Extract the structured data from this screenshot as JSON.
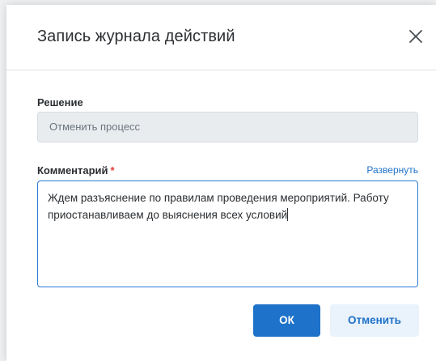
{
  "dialog": {
    "title": "Запись журнала действий",
    "close_icon": "close-icon"
  },
  "decision": {
    "label": "Решение",
    "value": "Отменить процесс"
  },
  "comment": {
    "label": "Комментарий",
    "required_mark": "*",
    "expand_label": "Развернуть",
    "value": "Ждем разъяснение по правилам проведения мероприятий. Работу приостанавливаем до выяснения всех условий"
  },
  "buttons": {
    "ok_label": "ОК",
    "cancel_label": "Отменить"
  },
  "colors": {
    "accent": "#1e72c9",
    "required": "#e53935"
  }
}
